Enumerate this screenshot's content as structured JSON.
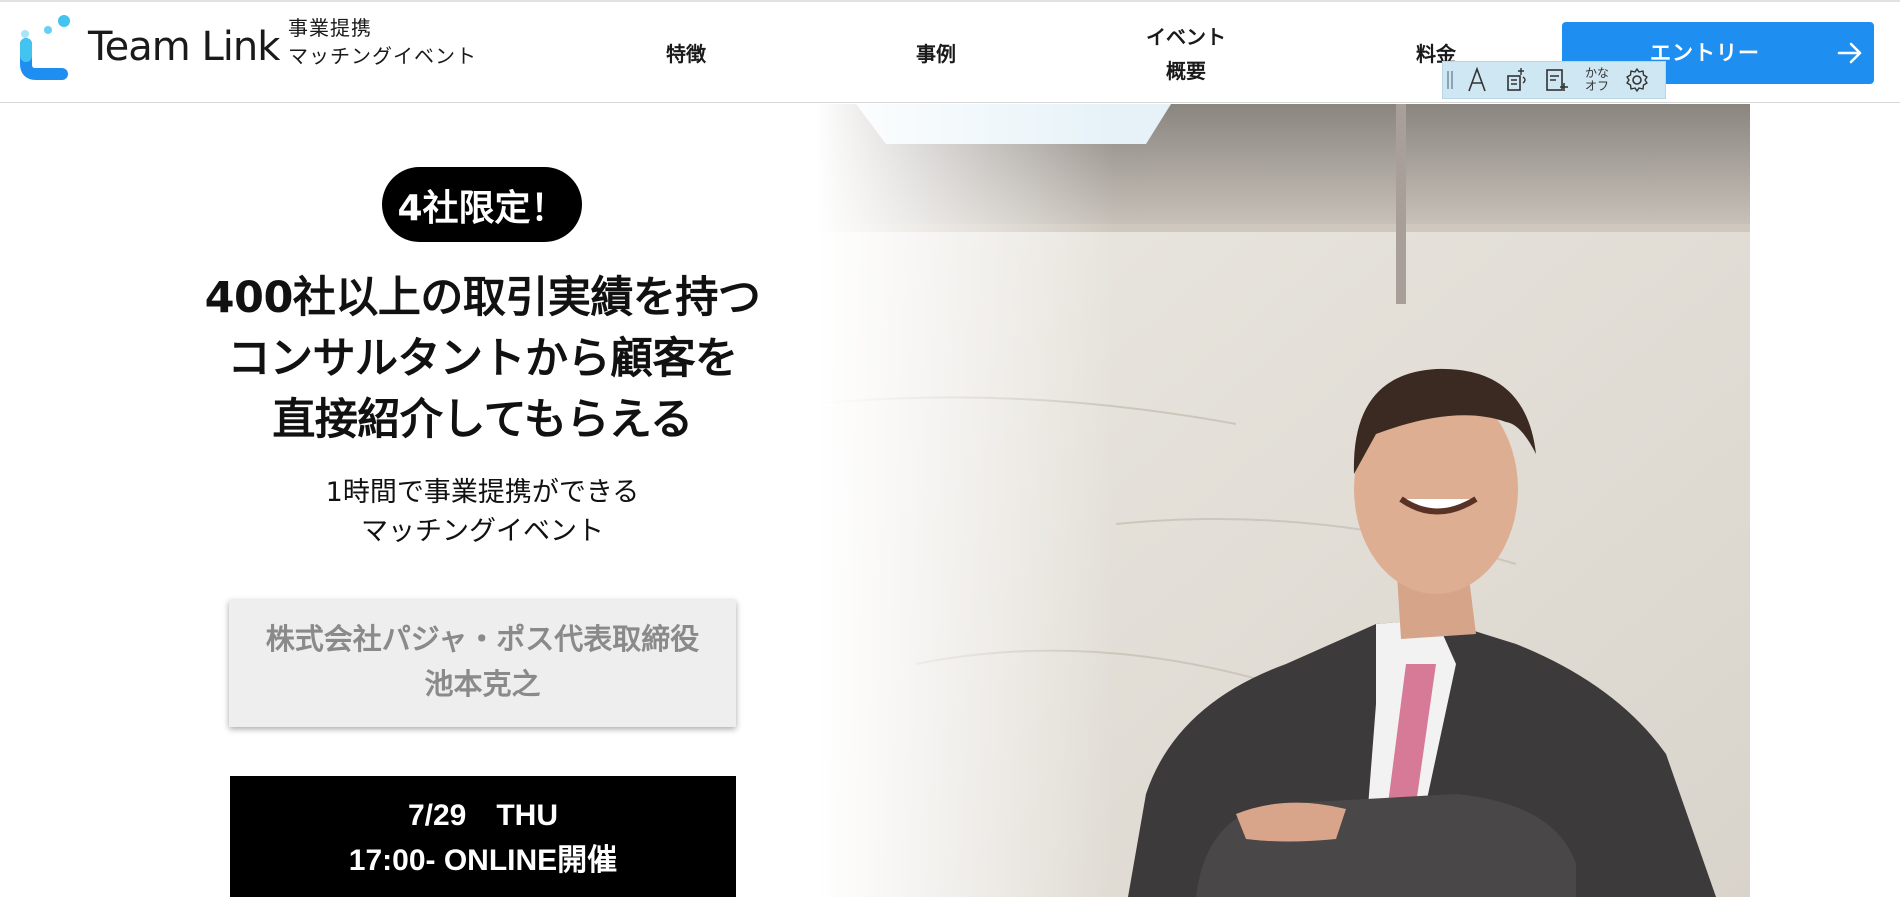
{
  "header": {
    "logo_text": "Team Link",
    "brand_sub": [
      "事業提携",
      "マッチングイベント"
    ],
    "nav": [
      {
        "lines": [
          "特徴"
        ]
      },
      {
        "lines": [
          "事例"
        ]
      },
      {
        "lines": [
          "イベント",
          "概要"
        ]
      },
      {
        "lines": [
          "料金"
        ]
      }
    ],
    "entry_label": "エントリー"
  },
  "a11y_toolbar": {
    "tools": [
      "text-size-icon",
      "read-aloud-icon",
      "ruby-icon",
      "kana-off",
      "settings-icon"
    ],
    "kana_top": "かな",
    "kana_bottom": "オフ"
  },
  "hero": {
    "badge": "4社限定！",
    "headline": [
      "400社以上の取引実績を持つ",
      "コンサルタントから顧客を",
      "直接紹介してもらえる"
    ],
    "subline": [
      "1時間で事業提携ができる",
      "マッチングイベント"
    ],
    "speaker": [
      "株式会社パジャ・ポス代表取締役",
      "池本克之"
    ],
    "date": [
      "7/29　THU",
      "17:00- ONLINE開催"
    ]
  },
  "colors": {
    "accent": "#1e8ff0",
    "logo_light": "#43c3f0",
    "logo_dark": "#1a6fe0",
    "toolbar_bg": "#cfe6f3"
  }
}
